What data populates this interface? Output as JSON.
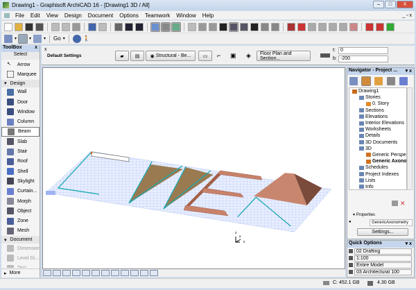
{
  "window": {
    "title": "Drawing1 - Graphisoft ArchiCAD 16 - [Drawing1 3D / All]",
    "close": "X"
  },
  "menu": [
    "File",
    "Edit",
    "View",
    "Design",
    "Document",
    "Options",
    "Teamwork",
    "Window",
    "Help"
  ],
  "toolbar2": {
    "go_label": "Go"
  },
  "toolbox": {
    "title": "ToolBox",
    "close": "x",
    "select_label": "Select",
    "items": [
      {
        "label": "Arrow",
        "type": "tool"
      },
      {
        "label": "Marquee",
        "type": "tool"
      },
      {
        "label": "Design",
        "type": "section"
      },
      {
        "label": "Wall",
        "type": "tool",
        "color": "#4a6fa5"
      },
      {
        "label": "Door",
        "type": "tool",
        "color": "#3a4f80"
      },
      {
        "label": "Window",
        "type": "tool",
        "color": "#3a4f80"
      },
      {
        "label": "Column",
        "type": "tool",
        "color": "#6c7fc0"
      },
      {
        "label": "Beam",
        "type": "tool",
        "selected": true,
        "color": "#777"
      },
      {
        "label": "Slab",
        "type": "tool",
        "color": "#556"
      },
      {
        "label": "Stair",
        "type": "tool",
        "color": "#6677aa"
      },
      {
        "label": "Roof",
        "type": "tool",
        "color": "#4a5f9a"
      },
      {
        "label": "Shell",
        "type": "tool",
        "color": "#4a6fc5"
      },
      {
        "label": "Skylight",
        "type": "tool",
        "color": "#445"
      },
      {
        "label": "Curtain...",
        "type": "tool",
        "color": "#6a7fd0"
      },
      {
        "label": "Morph",
        "type": "tool",
        "color": "#889"
      },
      {
        "label": "Object",
        "type": "tool",
        "color": "#556"
      },
      {
        "label": "Zone",
        "type": "tool",
        "color": "#4a5f9a"
      },
      {
        "label": "Mesh",
        "type": "tool",
        "color": "#667"
      },
      {
        "label": "Document",
        "type": "section"
      },
      {
        "label": "Dimension",
        "type": "tool",
        "dim": true,
        "color": "#bbb"
      },
      {
        "label": "Level Di...",
        "type": "tool",
        "dim": true,
        "color": "#bbb"
      },
      {
        "label": "Text",
        "type": "tool",
        "dim": true,
        "color": "#bbb"
      }
    ],
    "more_label": "More"
  },
  "infobox": {
    "default_settings": "Default Settings",
    "structural": "Structural - Be...",
    "floor_plan": "Floor Plan and Section...",
    "t_label": "t:",
    "t_value": "0",
    "b_label": "b:",
    "b_value": "-200"
  },
  "navigator": {
    "title": "Navigator - Project ...",
    "tree": [
      {
        "label": "Drawing1",
        "level": 0,
        "color": "#c86a1a"
      },
      {
        "label": "Stories",
        "level": 1
      },
      {
        "label": "0. Story",
        "level": 2,
        "color": "#e08a2a"
      },
      {
        "label": "Sections",
        "level": 1
      },
      {
        "label": "Elevations",
        "level": 1
      },
      {
        "label": "Interior Elevations",
        "level": 1
      },
      {
        "label": "Worksheets",
        "level": 1
      },
      {
        "label": "Details",
        "level": 1
      },
      {
        "label": "3D Documents",
        "level": 1
      },
      {
        "label": "3D",
        "level": 1
      },
      {
        "label": "Generic Perspective",
        "level": 2,
        "color": "#d07020"
      },
      {
        "label": "Generic Axonometry",
        "level": 2,
        "bold": true,
        "color": "#d07020"
      },
      {
        "label": "Schedules",
        "level": 1
      },
      {
        "label": "Project Indexes",
        "level": 1
      },
      {
        "label": "Lists",
        "level": 1
      },
      {
        "label": "Info",
        "level": 1
      }
    ],
    "properties_label": "Properties",
    "properties_value": "GenericAxonometry",
    "settings_label": "Settings..."
  },
  "quick_options": {
    "title": "Quick Options",
    "rows": [
      "02 Drafting",
      "1:100",
      "Entire Model",
      "03 Architectural 100"
    ]
  },
  "status": {
    "disk": "C: 452.1 GB",
    "memory": "4.30 GB"
  },
  "axes": {
    "x": "x",
    "y": "y",
    "z": "z"
  },
  "colors": {
    "grid": "#9fb4f0",
    "cyan": "#1aa8b0",
    "brick": "#c8826a",
    "triangle": "#9a7a50"
  }
}
